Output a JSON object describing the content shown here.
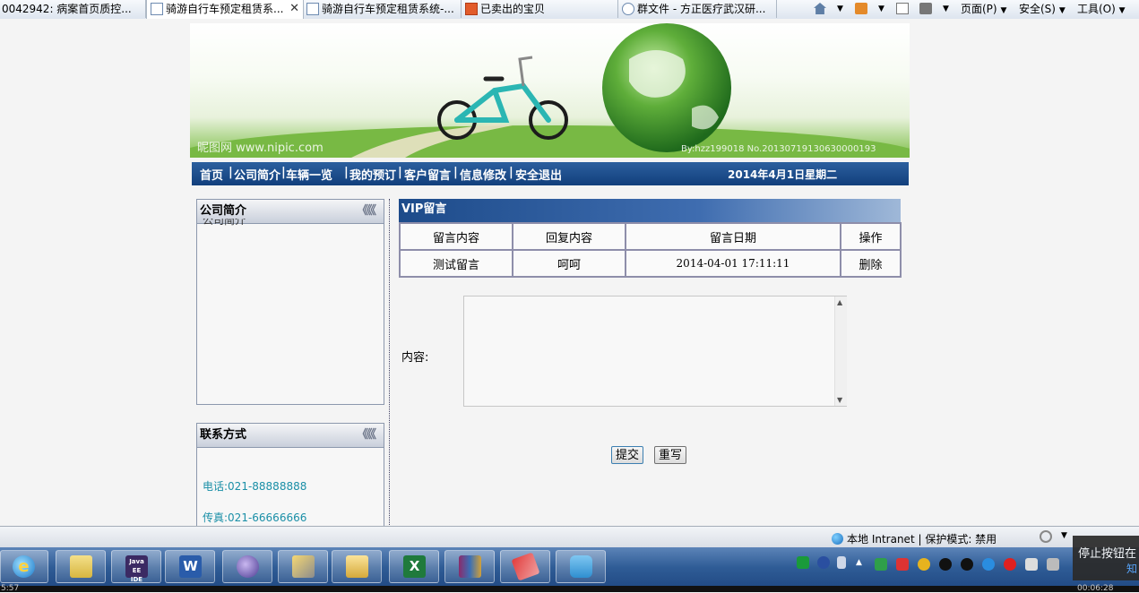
{
  "browser": {
    "tabs": [
      {
        "label": "0042942: 病案首页质控..."
      },
      {
        "label": "骑游自行车预定租赁系...",
        "active": true
      },
      {
        "label": "骑游自行车预定租赁系统-..."
      },
      {
        "label": "已卖出的宝贝"
      },
      {
        "label": "群文件 - 方正医疗武汉研..."
      }
    ],
    "menus": {
      "page": "页面(P)",
      "safety": "安全(S)",
      "tools": "工具(O)"
    }
  },
  "banner": {
    "watermark_left": "昵图网 www.nipic.com",
    "watermark_right": "By:hzz199018  No.20130719130630000193"
  },
  "nav": {
    "items": [
      "首页",
      "公司简介",
      "车辆一览",
      "我的预订",
      "客户留言",
      "信息修改",
      "安全退出"
    ],
    "date": "2014年4月1日星期二"
  },
  "sidebar": {
    "about": {
      "title": "公司简介",
      "body": "公司简介",
      "chevrons": "《《《"
    },
    "contact": {
      "title": "联系方式",
      "chevrons": "《《《",
      "phone": "电话:021-88888888",
      "fax": "传真:021-66666666"
    }
  },
  "messages": {
    "title": "VIP留言",
    "columns": [
      "留言内容",
      "回复内容",
      "留言日期",
      "操作"
    ],
    "rows": [
      {
        "content": "测试留言",
        "reply": "呵呵",
        "date": "2014-04-01 17:11:11",
        "action": "删除"
      }
    ]
  },
  "form": {
    "content_label": "内容:",
    "textarea_value": "",
    "submit_label": "提交",
    "reset_label": "重写"
  },
  "statusbar": {
    "zone": "本地 Intranet | 保护模式: 禁用"
  },
  "notification": {
    "text": "停止按钮在"
  },
  "taskbar": {
    "apps": [
      "internet-explorer",
      "folder",
      "java-ee-ide",
      "word",
      "eclipse",
      "snipping-tool",
      "file-manager",
      "excel",
      "winrar",
      "notepad-plus",
      "qq-window"
    ],
    "java_label": "Java EE IDE",
    "word_label": "W",
    "excel_label": "X"
  },
  "clock": {
    "left": "5:57",
    "right": "00:06:28"
  }
}
